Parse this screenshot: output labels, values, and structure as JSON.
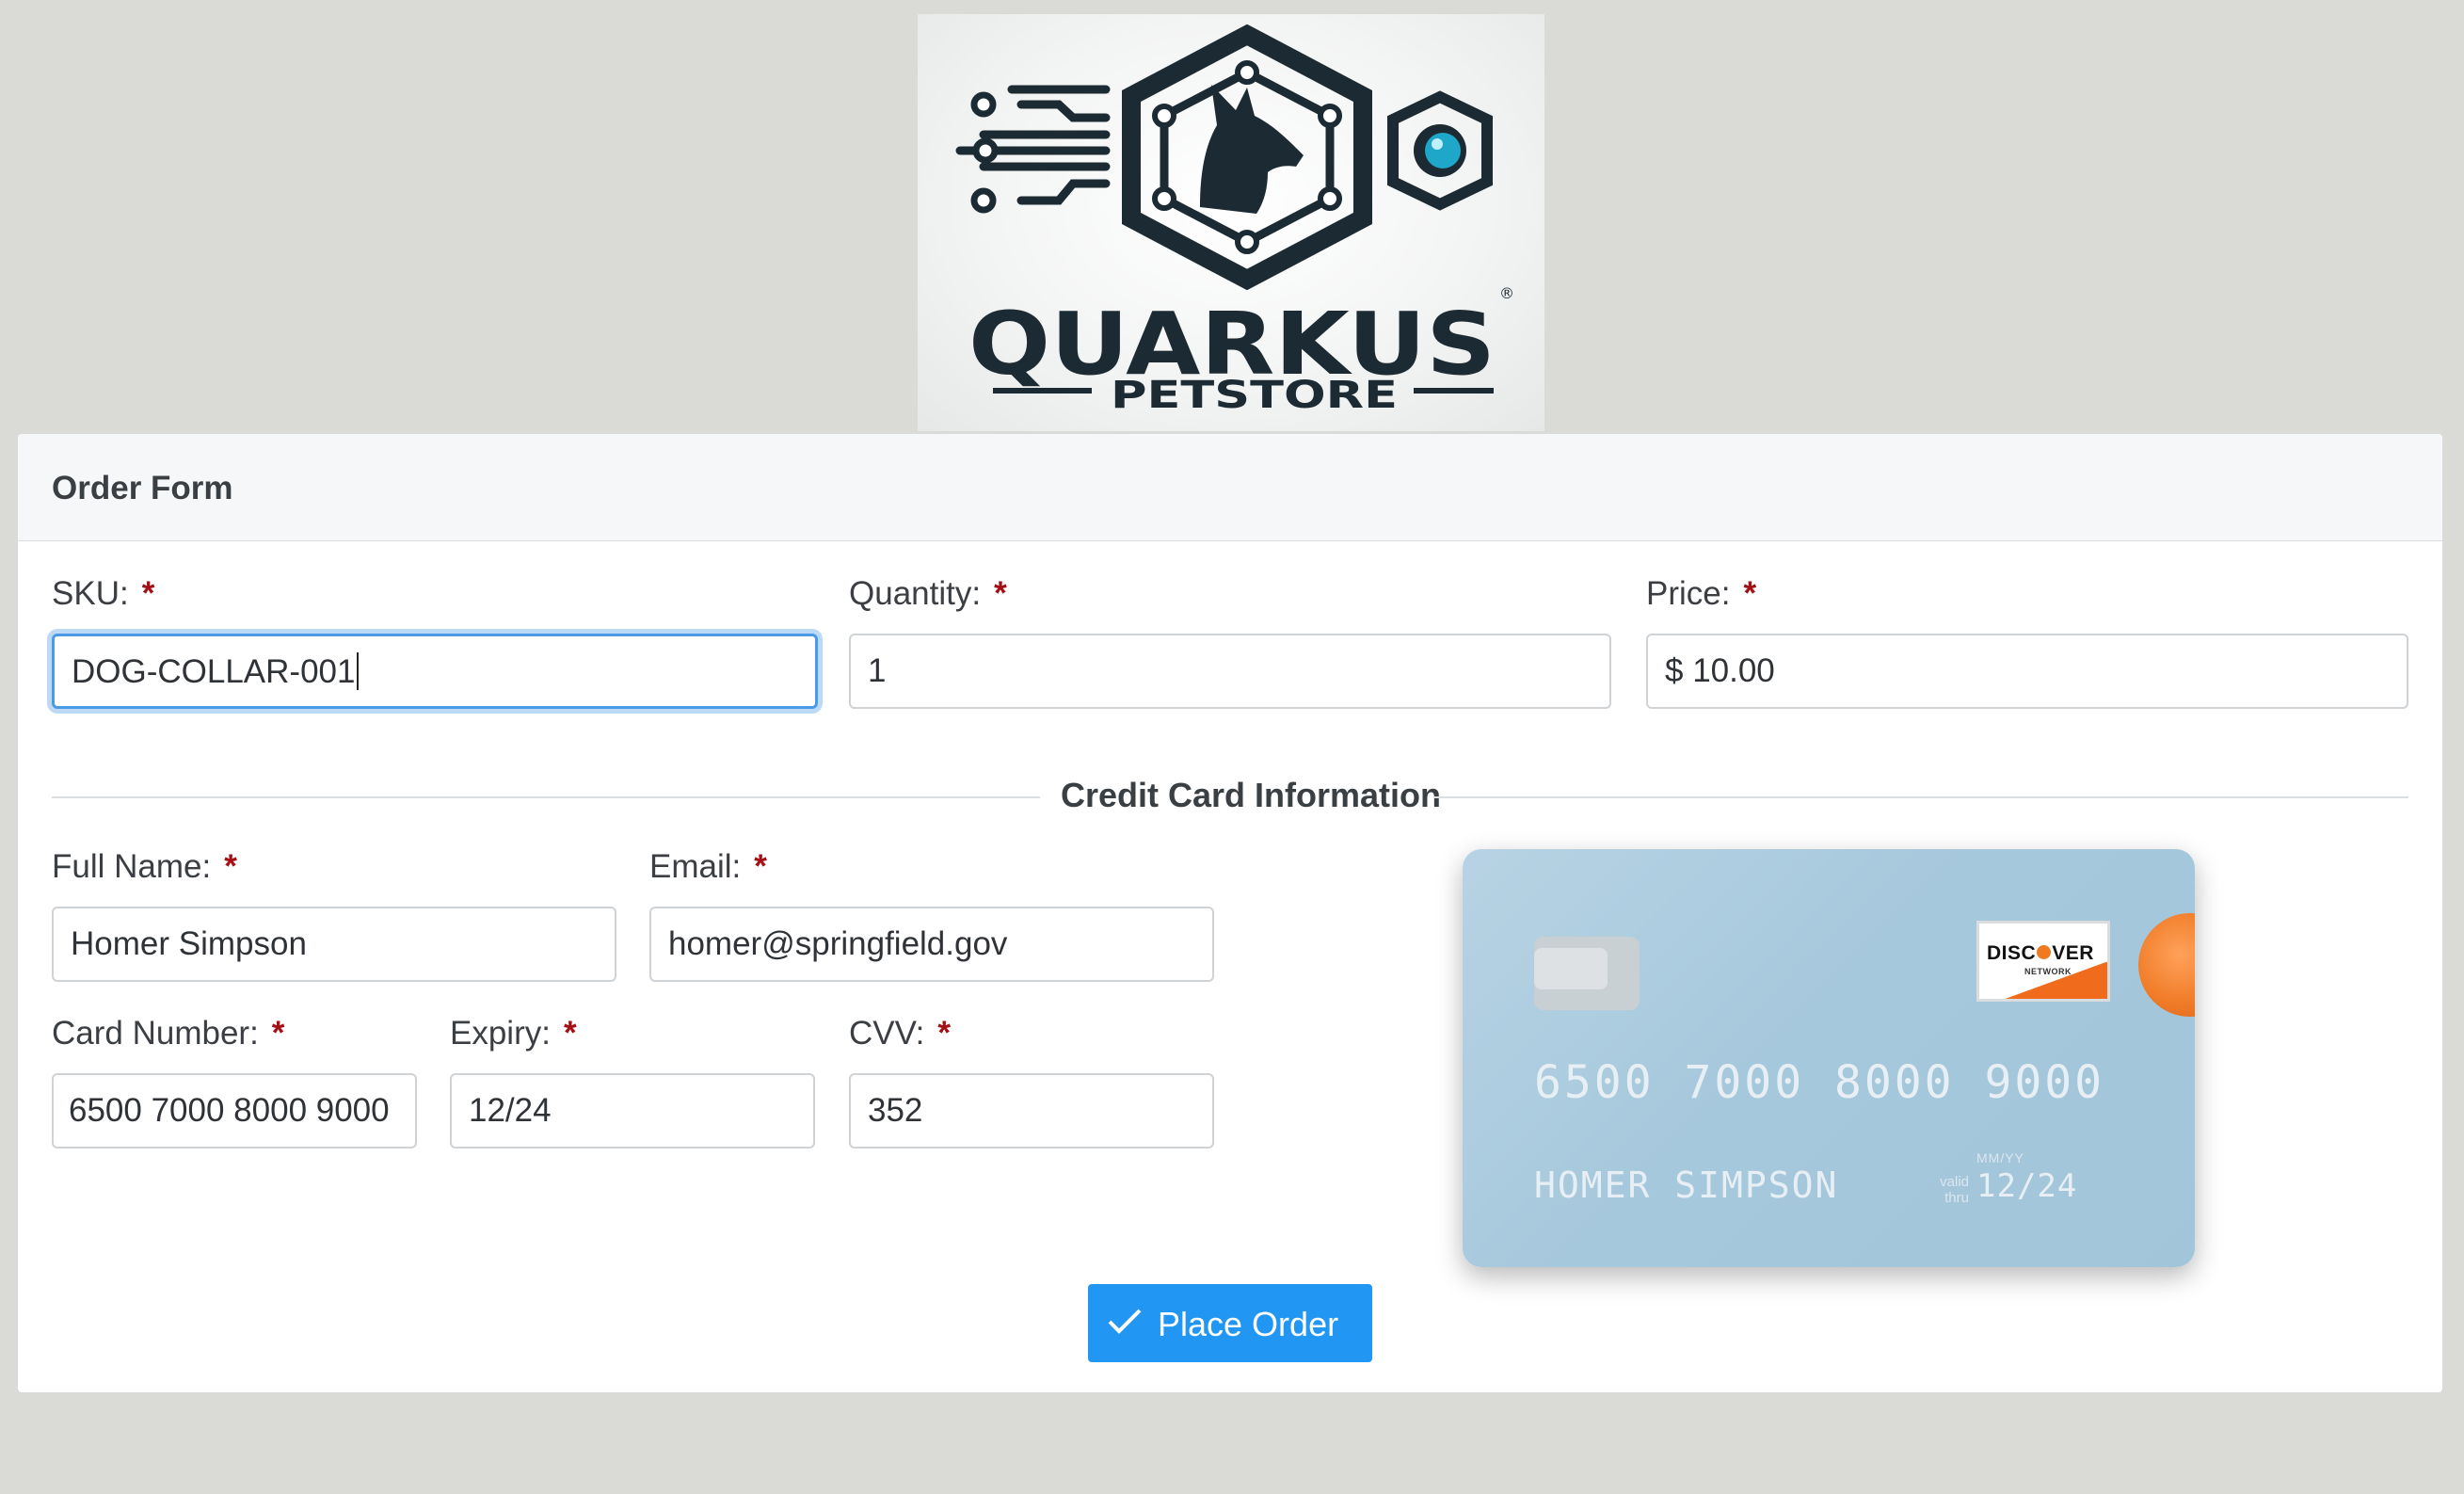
{
  "logo": {
    "brand": "QUARKUS",
    "sub": "PETSTORE",
    "reg": "®"
  },
  "form": {
    "title": "Order Form",
    "sku": {
      "label": "SKU:",
      "value": "DOG-COLLAR-001"
    },
    "quantity": {
      "label": "Quantity:",
      "value": "1"
    },
    "price": {
      "label": "Price:",
      "value": "$ 10.00"
    },
    "required_mark": "*",
    "section_title": "Credit Card Information",
    "full_name": {
      "label": "Full Name:",
      "value": "Homer Simpson"
    },
    "email": {
      "label": "Email:",
      "value": "homer@springfield.gov"
    },
    "card_number": {
      "label": "Card Number:",
      "value": "6500 7000 8000 9000"
    },
    "expiry": {
      "label": "Expiry:",
      "value": "12/24"
    },
    "cvv": {
      "label": "CVV:",
      "value": "352"
    },
    "submit_label": "Place Order"
  },
  "card_preview": {
    "number": "6500 7000 8000 9000",
    "name": "HOMER SIMPSON",
    "expiry_format": "MM/YY",
    "valid_thru": "valid thru",
    "expiry": "12/24",
    "brand": "DISCOVER",
    "brand_sub": "NETWORK"
  },
  "colors": {
    "page_bg": "#dadbd6",
    "accent": "#2196f3",
    "required": "#a30f14",
    "card_bg": "#a6c8dc",
    "discover_orange": "#f07a20"
  }
}
